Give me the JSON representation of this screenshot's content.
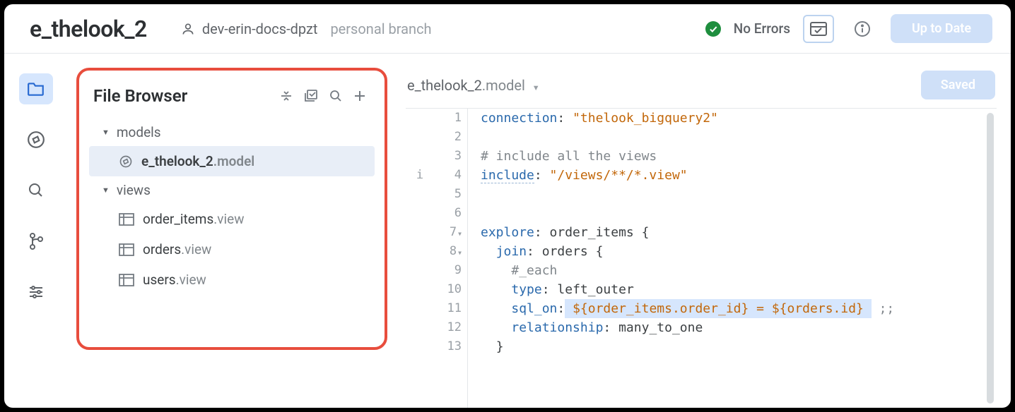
{
  "header": {
    "project": "e_thelook_2",
    "branch": "dev-erin-docs-dpzt",
    "branch_hint": "personal branch",
    "no_errors": "No Errors",
    "uptodate": "Up to Date"
  },
  "fb": {
    "title": "File Browser",
    "folders": [
      {
        "name": "models"
      },
      {
        "name": "views"
      }
    ],
    "model_file": {
      "name": "e_thelook_2",
      "ext": ".model"
    },
    "views": [
      {
        "name": "order_items",
        "ext": ".view"
      },
      {
        "name": "orders",
        "ext": ".view"
      },
      {
        "name": "users",
        "ext": ".view"
      }
    ]
  },
  "editor": {
    "tab_name": "e_thelook_2",
    "tab_ext": ".model",
    "saved": "Saved"
  },
  "code": {
    "l1": {
      "kw": "connection",
      "col": ":",
      "str": "\"thelook_bigquery2\""
    },
    "l3": {
      "cmt": "# include all the views"
    },
    "l4": {
      "kw": "include",
      "col": ":",
      "str": "\"/views/**/*.view\""
    },
    "l7": {
      "kw": "explore",
      "col": ":",
      "id": "order_items",
      "brace": " {"
    },
    "l8": {
      "kw": "join",
      "col": ":",
      "id": "orders",
      "brace": " {"
    },
    "l9": {
      "cmt": "#_each"
    },
    "l10": {
      "kw": "type",
      "col": ":",
      "id": "left_outer"
    },
    "l11": {
      "kw": "sql_on",
      "col": ":",
      "expr": "${order_items.order_id} = ${orders.id}",
      "tail": " ;;"
    },
    "l12": {
      "kw": "relationship",
      "col": ":",
      "id": "many_to_one"
    },
    "l13": {
      "brace": "}"
    }
  },
  "gut": {
    "l4i": "i",
    "l1": "1",
    "l2": "2",
    "l3": "3",
    "l4": "4",
    "l5": "5",
    "l6": "6",
    "l7": "7",
    "l8": "8",
    "l9": "9",
    "l10": "10",
    "l11": "11",
    "l12": "12",
    "l13": "13"
  }
}
